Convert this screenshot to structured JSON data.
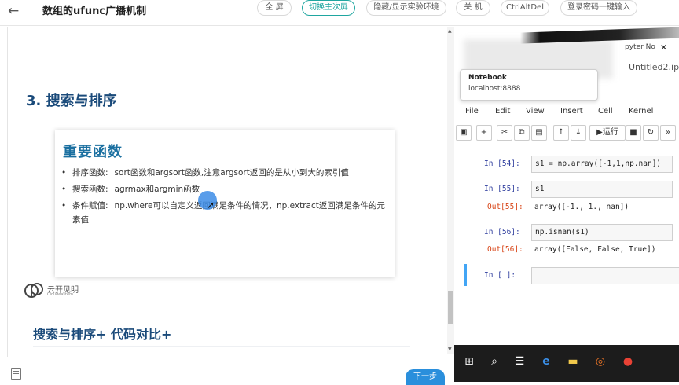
{
  "header": {
    "back_icon": "arrow-left-icon",
    "title": "数组的ufunc广播机制",
    "buttons": [
      {
        "label": "全 屏"
      },
      {
        "label": "切换主次屏"
      },
      {
        "label": "隐藏/显示实验环境"
      },
      {
        "label": "关 机"
      },
      {
        "label": "CtrlAltDel"
      },
      {
        "label": "登录密码一键输入"
      }
    ]
  },
  "slide": {
    "section_title": "3. 搜索与排序",
    "card_title": "重要函数",
    "items": [
      {
        "key": "排序函数:",
        "text": "sort函数和argsort函数,注意argsort返回的是从小到大的索引值"
      },
      {
        "key": "搜索函数:",
        "text": "agrmax和argmin函数"
      },
      {
        "key": "条件赋值:",
        "text": "np.where可以自定义返回满足条件的情况，np.extract返回满足条件的元素值"
      }
    ],
    "logo_text": "云开见明",
    "logo_sub": "Cloudeastern",
    "section2": "搜索与排序+ 代码对比+"
  },
  "footer": {
    "next_label": "下一步",
    "doc_icon": "document-icon"
  },
  "jupyter": {
    "tab_title": "pyter No",
    "url_text": "Untitled2.ip",
    "tooltip_title": "Notebook",
    "tooltip_host": "localhost:8888",
    "menu": [
      "File",
      "Edit",
      "View",
      "Insert",
      "Cell",
      "Kernel"
    ],
    "run_label": "运行",
    "cells": [
      {
        "in": "In  [54]:",
        "code": "s1 = np.array([-1,1,np.nan])"
      },
      {
        "in": "In  [55]:",
        "code": "s1",
        "out": "Out[55]:",
        "output": "array([-1.,  1.,  nan])"
      },
      {
        "in": "In  [56]:",
        "code": "np.isnan(s1)",
        "out": "Out[56]:",
        "output": "array([False, False,  True])"
      },
      {
        "in": "In  [ ]:",
        "code": ""
      }
    ]
  },
  "taskbar": {
    "icons": [
      "windows-start-icon",
      "search-icon",
      "task-view-icon",
      "edge-browser-icon",
      "file-explorer-icon",
      "jupyter-icon",
      "chrome-icon"
    ]
  }
}
